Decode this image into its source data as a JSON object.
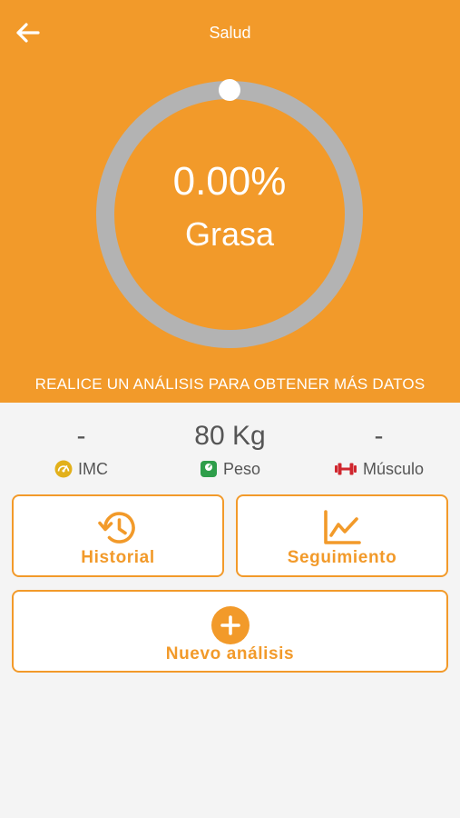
{
  "header": {
    "title": "Salud",
    "back_icon": "arrow-left-icon",
    "background_color": "#f29a2a"
  },
  "gauge": {
    "value": "0.00%",
    "label": "Grasa",
    "progress_fraction": 0.0,
    "track_color": "#b3b3b3"
  },
  "hint": "REALICE UN ANÁLISIS PARA OBTENER MÁS DATOS",
  "stats": [
    {
      "value": "-",
      "label": "IMC",
      "icon": "speedometer-icon",
      "icon_color": "#e2b01a"
    },
    {
      "value": "80 Kg",
      "label": "Peso",
      "icon": "scale-icon",
      "icon_color": "#2e9e4a"
    },
    {
      "value": "-",
      "label": "Músculo",
      "icon": "dumbbell-icon",
      "icon_color": "#d0262e"
    }
  ],
  "buttons": {
    "historial": {
      "label": "Historial",
      "icon": "history-icon"
    },
    "seguimiento": {
      "label": "Seguimiento",
      "icon": "line-chart-icon"
    },
    "nuevo": {
      "label": "Nuevo análisis",
      "icon": "plus-circle-icon"
    }
  },
  "accent_color": "#f29a2a"
}
